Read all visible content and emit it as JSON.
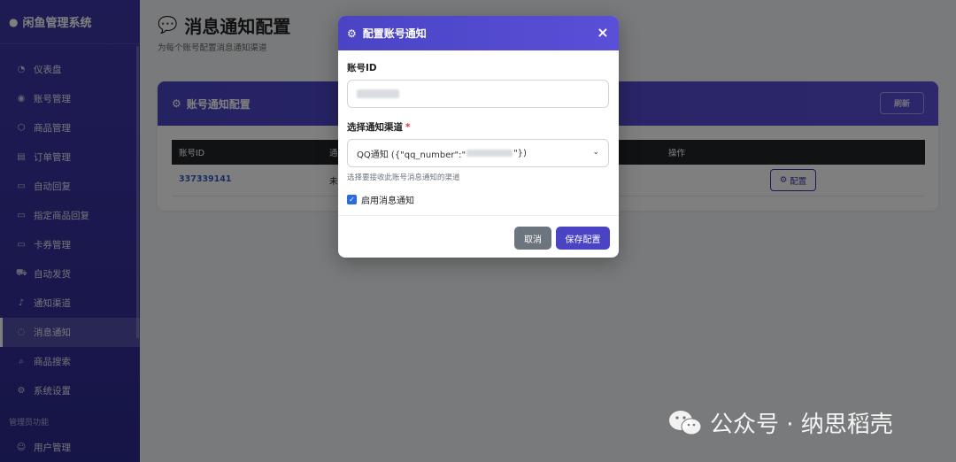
{
  "app": {
    "brand": "闲鱼管理系统"
  },
  "sidebar": {
    "items": [
      {
        "label": "仪表盘",
        "icon": "dashboard-icon",
        "glyph": "◔"
      },
      {
        "label": "账号管理",
        "icon": "user-circle-icon",
        "glyph": "◉"
      },
      {
        "label": "商品管理",
        "icon": "box-icon",
        "glyph": "⬡"
      },
      {
        "label": "订单管理",
        "icon": "list-icon",
        "glyph": "▤"
      },
      {
        "label": "自动回复",
        "icon": "chat-icon",
        "glyph": "▭"
      },
      {
        "label": "指定商品回复",
        "icon": "chat-icon",
        "glyph": "▭"
      },
      {
        "label": "卡券管理",
        "icon": "card-icon",
        "glyph": "▭"
      },
      {
        "label": "自动发货",
        "icon": "truck-icon",
        "glyph": "⛟"
      },
      {
        "label": "通知渠道",
        "icon": "bell-icon",
        "glyph": "♪"
      },
      {
        "label": "消息通知",
        "icon": "message-icon",
        "glyph": "◌"
      },
      {
        "label": "商品搜索",
        "icon": "search-icon",
        "glyph": "⌕"
      },
      {
        "label": "系统设置",
        "icon": "gear-icon",
        "glyph": "⚙"
      }
    ],
    "admin_section": "管理员功能",
    "admin_items": [
      {
        "label": "用户管理",
        "icon": "users-icon",
        "glyph": "☺"
      }
    ],
    "active_item": "消息通知"
  },
  "page": {
    "title": "消息通知配置",
    "subtitle": "为每个账号配置消息通知渠道"
  },
  "card": {
    "title": "账号通知配置",
    "refresh_label": "刷新",
    "columns": [
      "账号ID",
      "通",
      "操作"
    ],
    "rows": [
      {
        "account_id": "337339141",
        "status": "未",
        "action": "配置"
      }
    ]
  },
  "modal": {
    "title": "配置账号通知",
    "account_label": "账号ID",
    "channel_label": "选择通知渠道",
    "required_mark": "*",
    "channel_value_prefix": "QQ通知 ({\"qq_number\":\"",
    "channel_value_suffix": "\"})",
    "help_text": "选择要接收此账号消息通知的渠道",
    "enable_label": "启用消息通知",
    "enable_checked": true,
    "cancel_label": "取消",
    "save_label": "保存配置"
  },
  "watermark": {
    "text": "公众号 · 纳思稻壳"
  },
  "colors": {
    "primary": "#4a44c4",
    "sidebar": "#3d37a8",
    "danger": "#dc3545",
    "secondary": "#6c757d",
    "link": "#2f5fc4"
  }
}
